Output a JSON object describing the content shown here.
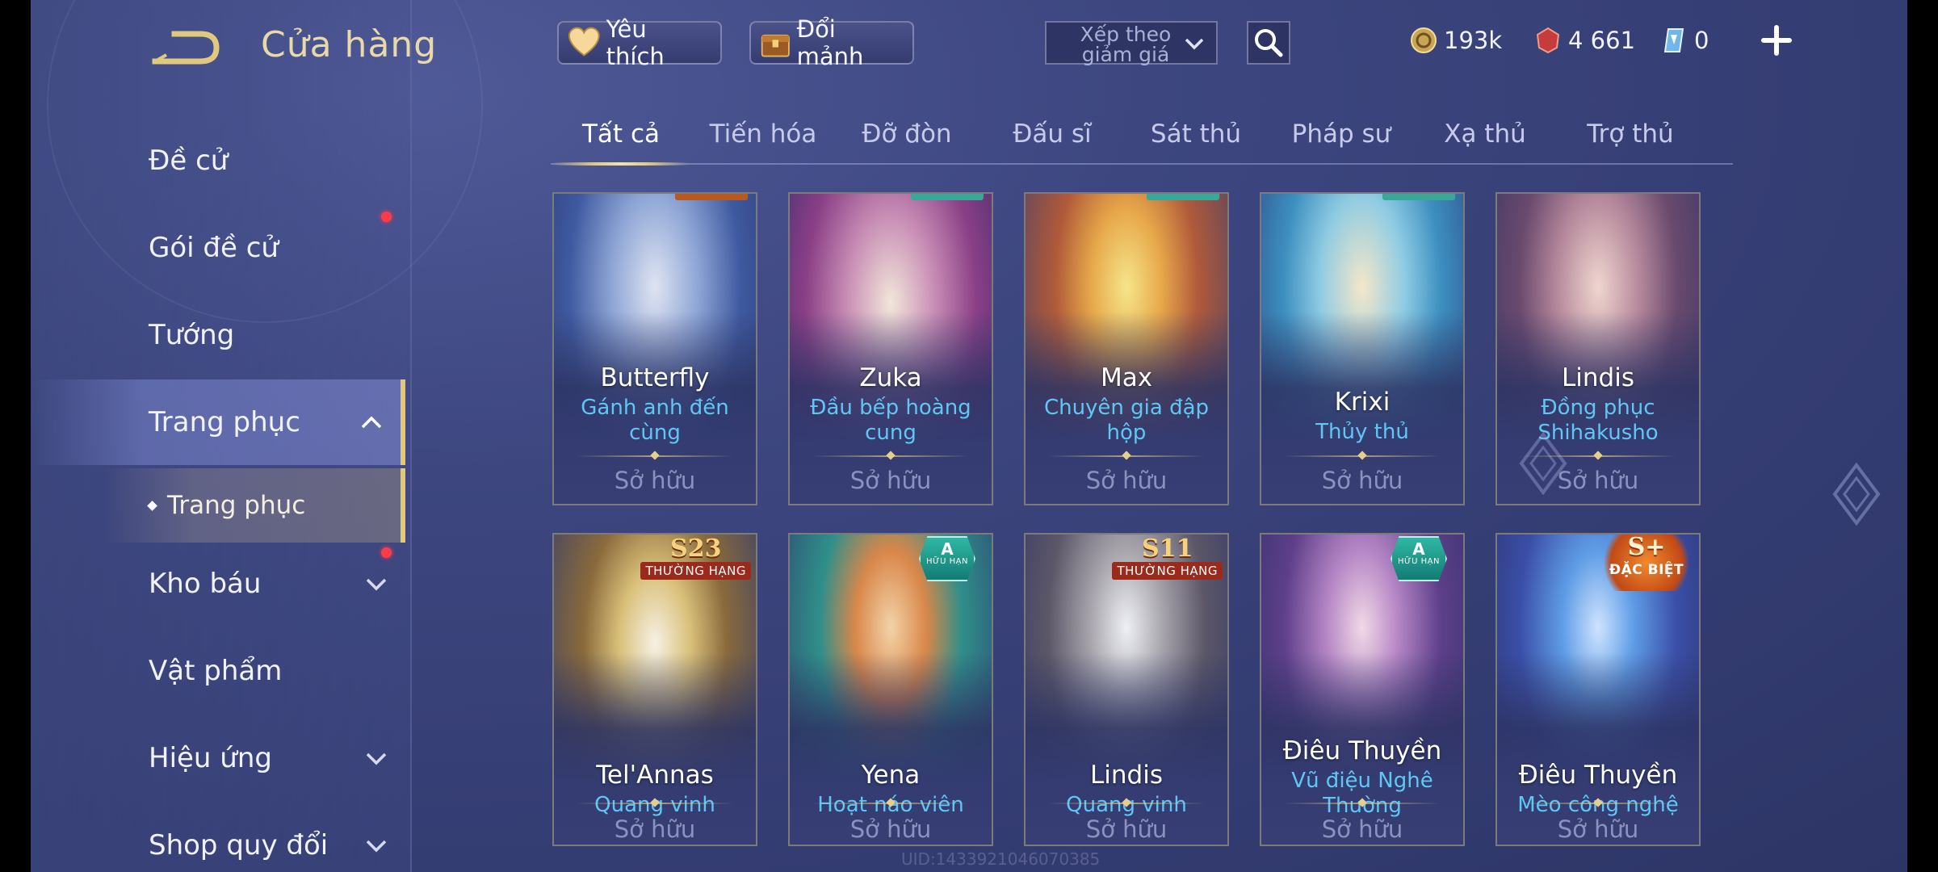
{
  "header": {
    "title": "Cửa hàng",
    "favorite_label": "Yêu thích",
    "exchange_label": "Đổi mảnh",
    "sort_label": "Xếp theo giảm giá",
    "currencies": [
      {
        "icon": "gold-coin-icon",
        "value": "193k"
      },
      {
        "icon": "red-voucher-icon",
        "value": "4 661"
      },
      {
        "icon": "blue-crystal-icon",
        "value": "0"
      }
    ]
  },
  "sidebar": {
    "items": [
      {
        "label": "Đề cử"
      },
      {
        "label": "Gói đề cử"
      },
      {
        "label": "Tướng"
      },
      {
        "label": "Trang phục"
      },
      {
        "label": "Kho báu"
      },
      {
        "label": "Vật phẩm"
      },
      {
        "label": "Hiệu ứng"
      },
      {
        "label": "Shop quy đổi"
      }
    ],
    "sub_item": "Trang phục"
  },
  "tabs": [
    "Tất cả",
    "Tiến hóa",
    "Đỡ đòn",
    "Đấu sĩ",
    "Sát thủ",
    "Pháp sư",
    "Xạ thủ",
    "Trợ thủ"
  ],
  "cards": [
    {
      "hero": "Butterfly",
      "skin": "Gánh anh đến cùng",
      "status": "Sở hữu"
    },
    {
      "hero": "Zuka",
      "skin": "Đầu bếp hoàng cung",
      "status": "Sở hữu"
    },
    {
      "hero": "Max",
      "skin": "Chuyên gia đập hộp",
      "status": "Sở hữu"
    },
    {
      "hero": "Krixi",
      "skin": "Thủy thủ",
      "status": "Sở hữu"
    },
    {
      "hero": "Lindis",
      "skin": "Đồng phục Shihakusho",
      "status": "Sở hữu"
    },
    {
      "hero": "Tel'Annas",
      "skin": "Quang vinh",
      "status": "Sở hữu",
      "badge": "S23",
      "badge_sub": "THƯỜNG HẠNG"
    },
    {
      "hero": "Yena",
      "skin": "Hoạt náo viên",
      "status": "Sở hữu",
      "badge": "A",
      "badge_sub": "HỮU HẠN"
    },
    {
      "hero": "Lindis",
      "skin": "Quang vinh",
      "status": "Sở hữu",
      "badge": "S11",
      "badge_sub": "THƯỜNG HẠNG"
    },
    {
      "hero": "Điêu Thuyền",
      "skin": "Vũ điệu Nghê Thường",
      "status": "Sở hữu",
      "badge": "A",
      "badge_sub": "HỮU HẠN"
    },
    {
      "hero": "Điêu Thuyền",
      "skin": "Mèo công nghệ",
      "status": "Sở hữu",
      "badge": "S+",
      "badge_sub": "ĐẶC BIỆT"
    }
  ],
  "watermark": "UID:1433921046070385",
  "colors": {
    "accent_gold": "#e0c97d",
    "skin_name": "#5fc7f4",
    "notification": "#ff3b4a"
  }
}
